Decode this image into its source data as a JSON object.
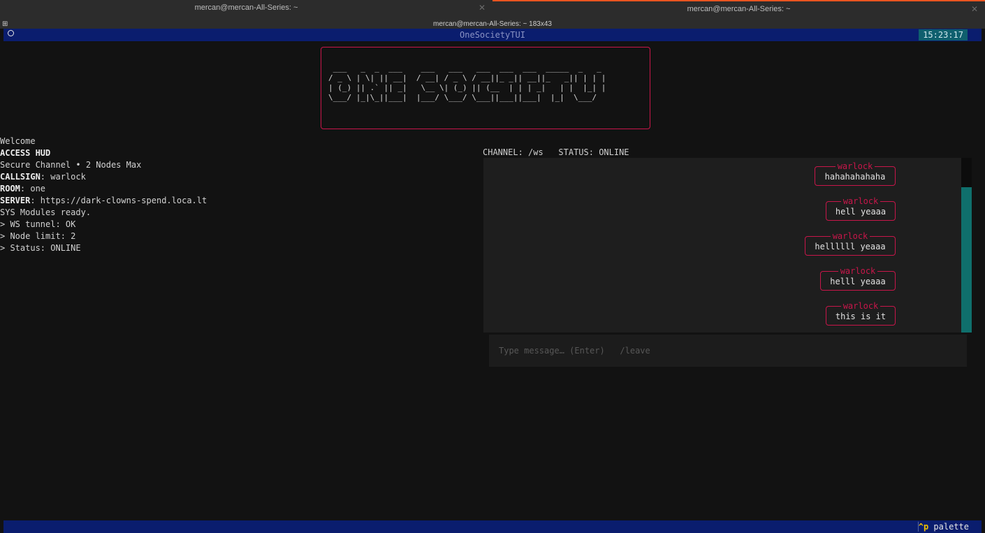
{
  "window": {
    "tabs": [
      {
        "label": "mercan@mercan-All-Series: ~"
      },
      {
        "label": "mercan@mercan-All-Series: ~"
      }
    ],
    "title": "mercan@mercan-All-Series: ~ 183x43"
  },
  "app": {
    "title": "OneSocietyTUI",
    "clock": "15:23:17",
    "logo": " ___   _  _  ___    ___   ___   ___  ___  ___  _____  _   _ \n/ _ \\ | \\| || __|  / __| / _ \\ / __||_ _|| __||_   _|| | | |\n| (_) || .` || _|   \\__ \\| (_) || (__  | | | _|   | |  |_| |\n\\___/ |_|\\_||___|  |___/ \\___/ \\___||___||___|  |_|  \\___/ "
  },
  "hud": {
    "welcome": "Welcome",
    "access_title": "ACCESS HUD",
    "secure_line": "Secure Channel • 2 Nodes Max",
    "callsign_label": "CALLSIGN",
    "callsign_value": ": warlock",
    "room_label": "ROOM",
    "room_value": ": one",
    "server_label": "SERVER",
    "server_value": ": https://dark-clowns-spend.loca.lt",
    "sys_line": "SYS Modules ready.",
    "ws_line": "> WS tunnel: OK",
    "node_line": "> Node limit: 2",
    "status_line": "> Status: ONLINE"
  },
  "channel": {
    "label": "CHANNEL: /ws",
    "status": "STATUS: ONLINE"
  },
  "messages": [
    {
      "author": "warlock",
      "text": "hahahahahaha"
    },
    {
      "author": "warlock",
      "text": "hell yeaaa"
    },
    {
      "author": "warlock",
      "text": "hellllll yeaaa"
    },
    {
      "author": "warlock",
      "text": "helll yeaaa"
    },
    {
      "author": "warlock",
      "text": "this is it"
    }
  ],
  "composer": {
    "placeholder": "Type message… (Enter)   /leave"
  },
  "footer": {
    "key": "^p",
    "label": " palette"
  },
  "colors": {
    "accent": "#c8164a",
    "header_bg": "#0a1d6e",
    "clock_bg": "#0f5f6e",
    "scroll_thumb": "#0f6f6c",
    "tab_indicator": "#e95420"
  }
}
